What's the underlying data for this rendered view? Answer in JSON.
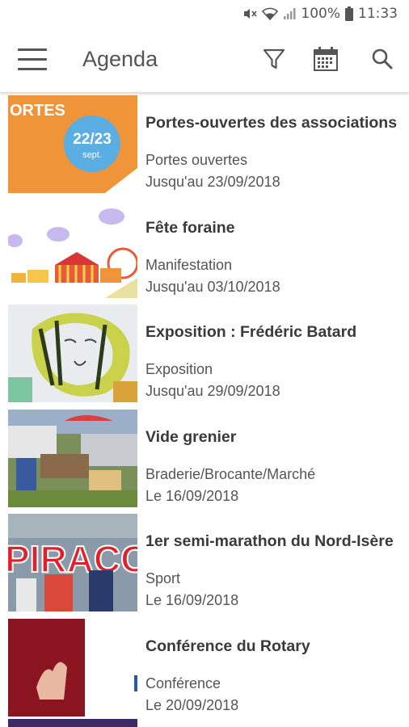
{
  "status_bar": {
    "battery": "100%",
    "time": "11:33"
  },
  "app_bar": {
    "title": "Agenda",
    "icons": [
      "menu-icon",
      "filter-icon",
      "calendar-icon",
      "search-icon"
    ]
  },
  "events": [
    {
      "title": "Portes-ouvertes des associations",
      "category": "Portes ouvertes",
      "date": "Jusqu'au 23/09/2018",
      "thumb_text": "ORTES",
      "badge_line1": "22/23",
      "badge_line2": "sept."
    },
    {
      "title": "Fête foraine",
      "category": "Manifestation",
      "date": "Jusqu'au 03/10/2018"
    },
    {
      "title": "Exposition : Frédéric Batard",
      "category": "Exposition",
      "date": "Jusqu'au 29/09/2018"
    },
    {
      "title": "Vide grenier",
      "category": "Braderie/Brocante/Marché",
      "date": "Le 16/09/2018"
    },
    {
      "title": "1er semi-marathon du Nord-Isère",
      "category": "Sport",
      "date": "Le 16/09/2018",
      "thumb_text": "PIRACC"
    },
    {
      "title": "Conférence du Rotary",
      "category": "Conférence",
      "date": "Le 20/09/2018"
    }
  ]
}
